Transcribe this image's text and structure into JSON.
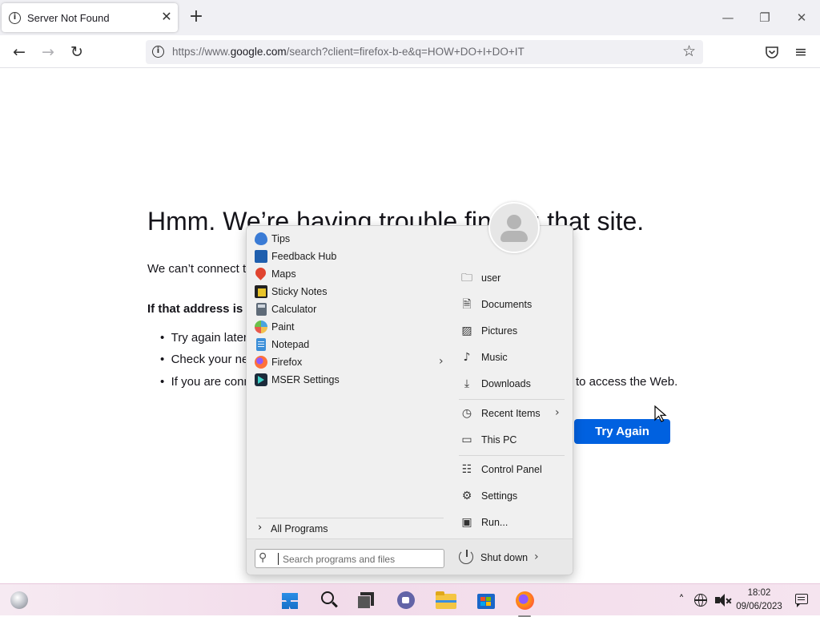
{
  "browser": {
    "tab_title": "Server Not Found",
    "tab_close": "✕",
    "new_tab": "+",
    "url_prefix": "https://www.",
    "url_host": "google.com",
    "url_path": "/search?client=firefox-b-e&q=HOW+DO+I+DO+IT",
    "window_controls": {
      "minimize": "—",
      "maximize": "❐",
      "close": "✕"
    }
  },
  "page": {
    "title": "Hmm. We’re having trouble finding that site.",
    "text": "We can’t connect to",
    "bold_heading": "If that address is",
    "bullets": [
      "Try again later",
      "Check your ne",
      "If you are conn"
    ],
    "bullet_tail": "to access the Web.",
    "try_again_button": "Try Again"
  },
  "start_menu": {
    "apps": [
      {
        "label": "Tips",
        "icon": "tips-icon",
        "color": "#3a7bd5"
      },
      {
        "label": "Feedback Hub",
        "icon": "feedback-hub-icon",
        "color": "#1f5fae"
      },
      {
        "label": "Maps",
        "icon": "maps-icon",
        "color": "#e0442f"
      },
      {
        "label": "Sticky Notes",
        "icon": "sticky-notes-icon",
        "color": "#e8c42a"
      },
      {
        "label": "Calculator",
        "icon": "calculator-icon",
        "color": "#5f6b78"
      },
      {
        "label": "Paint",
        "icon": "paint-icon",
        "color": "#4aa3df"
      },
      {
        "label": "Notepad",
        "icon": "notepad-icon",
        "color": "#3c8fd8"
      },
      {
        "label": "Firefox",
        "icon": "firefox-icon",
        "color": "#ff7139",
        "has_submenu": true
      },
      {
        "label": "MSER Settings",
        "icon": "mser-settings-icon",
        "color": "#1c2a3a"
      }
    ],
    "all_programs": "All Programs",
    "places": [
      {
        "label": "user",
        "icon": "user-folder-icon",
        "glyph": "🗀"
      },
      {
        "label": "Documents",
        "icon": "documents-icon",
        "glyph": "🗎"
      },
      {
        "label": "Pictures",
        "icon": "pictures-icon",
        "glyph": "▨"
      },
      {
        "label": "Music",
        "icon": "music-icon",
        "glyph": "♪"
      },
      {
        "label": "Downloads",
        "icon": "downloads-icon",
        "glyph": "⤓"
      },
      {
        "label": "Recent Items",
        "icon": "recent-items-icon",
        "glyph": "◷",
        "has_submenu": true
      },
      {
        "label": "This PC",
        "icon": "this-pc-icon",
        "glyph": "▭"
      },
      {
        "label": "Control Panel",
        "icon": "control-panel-icon",
        "glyph": "☷"
      },
      {
        "label": "Settings",
        "icon": "settings-icon",
        "glyph": "⚙"
      },
      {
        "label": "Run...",
        "icon": "run-icon",
        "glyph": "▣"
      }
    ],
    "search_placeholder": "Search programs and files",
    "shutdown_label": "Shut down"
  },
  "taskbar": {
    "time": "18:02",
    "date": "09/06/2023"
  },
  "colors": {
    "accent": "#0061e0",
    "menu_bg": "#f0f0f0",
    "taskbar_bg": "#f2dbea"
  }
}
